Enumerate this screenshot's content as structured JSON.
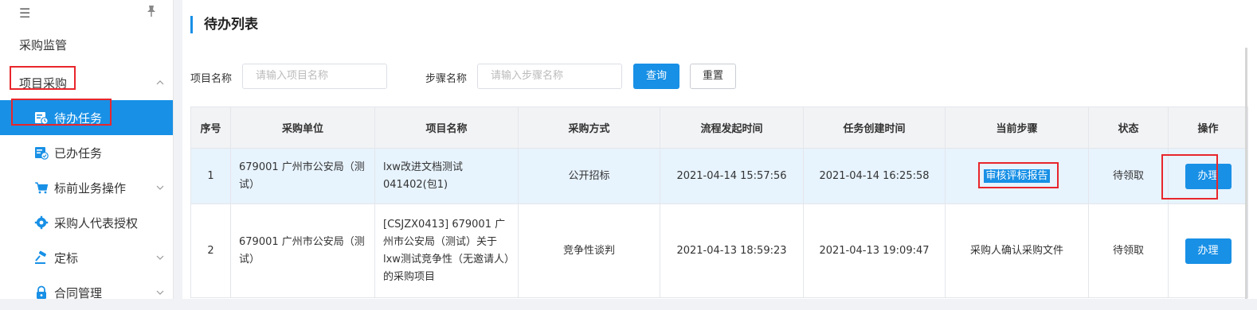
{
  "sidebar": {
    "top_menu_icon": "menu-icon",
    "pin_icon": "pin-icon",
    "items": [
      {
        "label": "采购监管",
        "icon": ""
      },
      {
        "label": "项目采购",
        "icon": "chevron-up-icon"
      },
      {
        "label": "待办任务",
        "icon": "task-pending-icon"
      },
      {
        "label": "已办任务",
        "icon": "task-done-icon"
      },
      {
        "label": "标前业务操作",
        "icon": "cart-icon"
      },
      {
        "label": "采购人代表授权",
        "icon": "gear-icon"
      },
      {
        "label": "定标",
        "icon": "gavel-icon"
      },
      {
        "label": "合同管理",
        "icon": "lock-icon"
      }
    ]
  },
  "main": {
    "title": "待办列表",
    "search": {
      "project_label": "项目名称",
      "project_placeholder": "请输入项目名称",
      "step_label": "步骤名称",
      "step_placeholder": "请输入步骤名称",
      "query_label": "查询",
      "reset_label": "重置"
    },
    "table": {
      "headers": [
        "序号",
        "采购单位",
        "项目名称",
        "采购方式",
        "流程发起时间",
        "任务创建时间",
        "当前步骤",
        "状态",
        "操作"
      ],
      "rows": [
        {
          "index": "1",
          "unit": "679001 广州市公安局（测试）",
          "project": "lxw改进文档测试041402(包1)",
          "method": "公开招标",
          "start_time": "2021-04-14 15:57:56",
          "create_time": "2021-04-14 16:25:58",
          "step": "审核评标报告",
          "status": "待领取",
          "action": "办理"
        },
        {
          "index": "2",
          "unit": "679001 广州市公安局（测试）",
          "project": "[CSJZX0413] 679001 广州市公安局（测试）关于lxw测试竞争性（无邀请人）的采购项目",
          "method": "竞争性谈判",
          "start_time": "2021-04-13 18:59:23",
          "create_time": "2021-04-13 19:09:47",
          "step": "采购人确认采购文件",
          "status": "待领取",
          "action": "办理"
        }
      ]
    }
  },
  "colors": {
    "accent": "#1890e6",
    "highlight_box": "#e8262c",
    "selected_row": "#e7f3fd"
  }
}
